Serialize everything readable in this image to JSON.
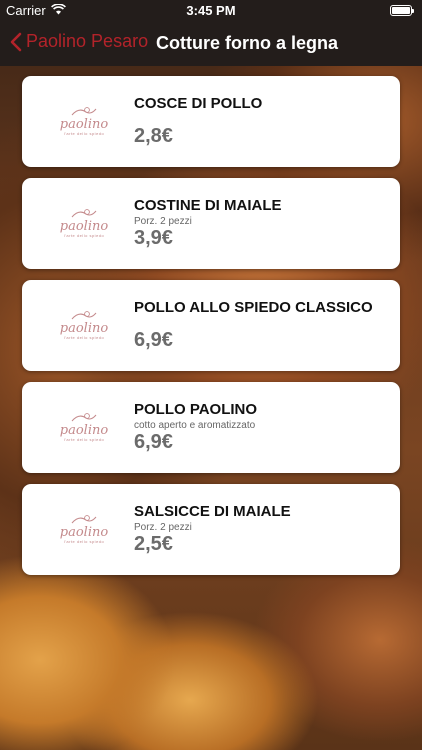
{
  "status": {
    "carrier": "Carrier",
    "time": "3:45 PM"
  },
  "nav": {
    "back_label": "Paolino Pesaro",
    "title": "Cotture forno a legna"
  },
  "colors": {
    "accent": "#b3232a",
    "bar": "#231d1b",
    "logo": "#c48a8c"
  },
  "logo": {
    "word": "paolino",
    "tagline": "l'arte dello spiedo"
  },
  "items": [
    {
      "name": "COSCE DI POLLO",
      "desc": "",
      "price": "2,8€"
    },
    {
      "name": "COSTINE DI MAIALE",
      "desc": "Porz. 2 pezzi",
      "price": "3,9€"
    },
    {
      "name": "POLLO ALLO SPIEDO CLASSICO",
      "desc": "",
      "price": "6,9€"
    },
    {
      "name": "POLLO PAOLINO",
      "desc": "cotto aperto e aromatizzato",
      "price": "6,9€"
    },
    {
      "name": "SALSICCE DI MAIALE",
      "desc": "Porz. 2 pezzi",
      "price": "2,5€"
    }
  ]
}
